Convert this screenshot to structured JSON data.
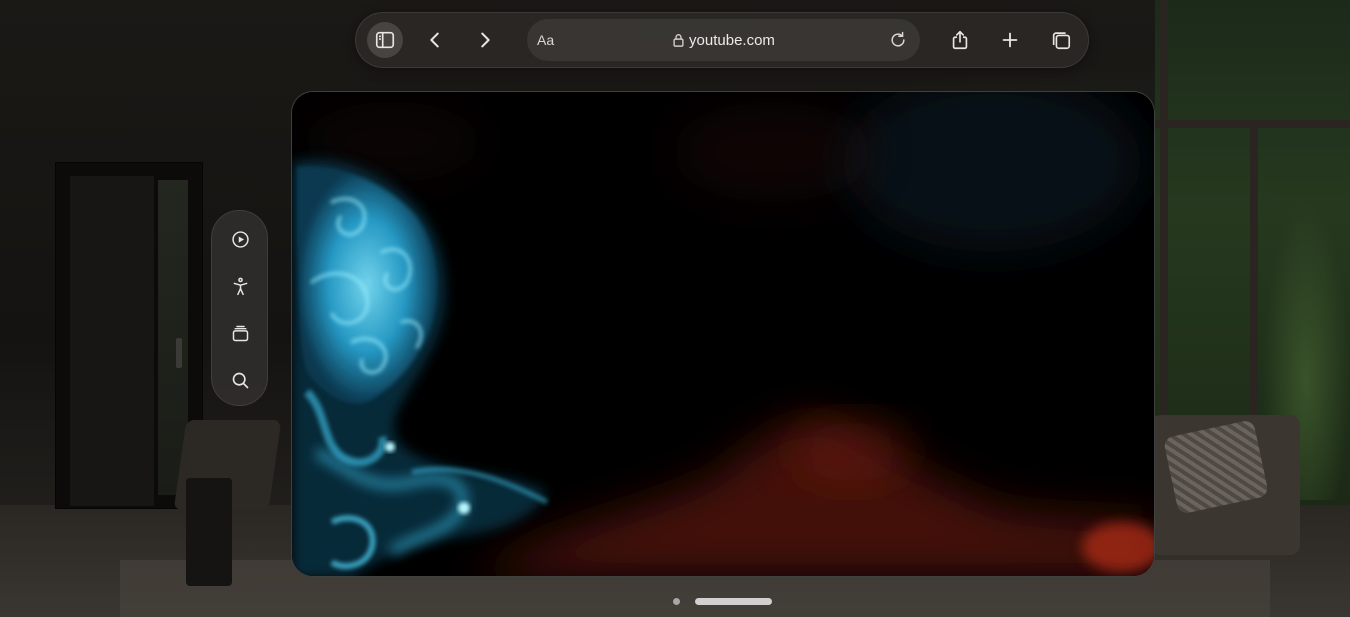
{
  "toolbar": {
    "reader_label": "Aa",
    "url": "youtube.com"
  },
  "icons": {
    "toolbar": [
      "sidebar-icon",
      "chevron-left-icon",
      "chevron-right-icon",
      "lock-icon",
      "reload-icon",
      "share-icon",
      "plus-icon",
      "tabs-icon"
    ],
    "ornament": [
      "play-circle-icon",
      "accessibility-icon",
      "stack-icon",
      "search-icon"
    ]
  },
  "colors": {
    "fluid_cyan": "#38c6f0",
    "fluid_red": "#6a1a10",
    "toolbar_bg": "#2a2826"
  }
}
